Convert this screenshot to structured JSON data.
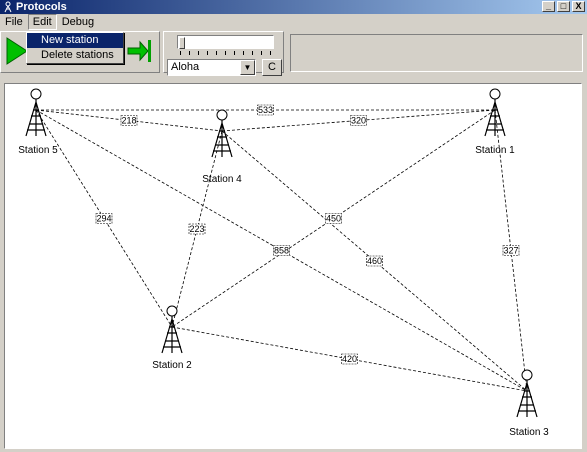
{
  "window": {
    "title": "Protocols",
    "minimize": "_",
    "maximize": "□",
    "close": "X"
  },
  "menu": {
    "file": "File",
    "edit": "Edit",
    "debug": "Debug"
  },
  "edit_menu": {
    "items": [
      "New station",
      "Delete stations"
    ],
    "highlighted": 0
  },
  "toolbar": {
    "protocol": "Aloha",
    "c_button": "C"
  },
  "stations": [
    {
      "id": "s5",
      "label": "Station 5"
    },
    {
      "id": "s4",
      "label": "Station 4"
    },
    {
      "id": "s1",
      "label": "Station 1"
    },
    {
      "id": "s2",
      "label": "Station 2"
    },
    {
      "id": "s3",
      "label": "Station 3"
    }
  ],
  "links": [
    {
      "from": "s5",
      "to": "s1",
      "weight": "533"
    },
    {
      "from": "s5",
      "to": "s4",
      "weight": "218"
    },
    {
      "from": "s4",
      "to": "s1",
      "weight": "320"
    },
    {
      "from": "s5",
      "to": "s2",
      "weight": "294"
    },
    {
      "from": "s4",
      "to": "s2",
      "weight": "223"
    },
    {
      "from": "s5",
      "to": "s3",
      "weight": "858"
    },
    {
      "from": "s1",
      "to": "s2",
      "weight": "450"
    },
    {
      "from": "s4",
      "to": "s3",
      "weight": "460"
    },
    {
      "from": "s1",
      "to": "s3",
      "weight": "327"
    },
    {
      "from": "s2",
      "to": "s3",
      "weight": "420"
    }
  ]
}
